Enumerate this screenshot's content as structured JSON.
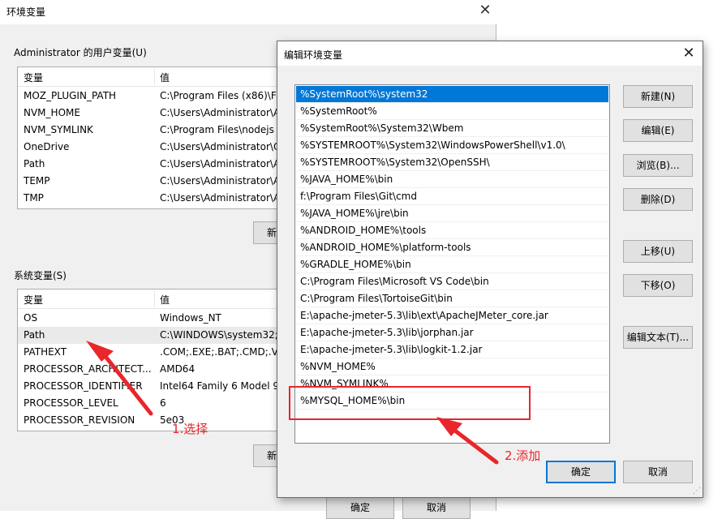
{
  "bg_window": {
    "title": "环境变量",
    "user_group_label": "Administrator 的用户变量(U)",
    "system_group_label": "系统变量(S)",
    "col_var": "变量",
    "col_val": "值",
    "user_vars": [
      {
        "name": "MOZ_PLUGIN_PATH",
        "value": "C:\\Program Files (x86)\\Fo"
      },
      {
        "name": "NVM_HOME",
        "value": "C:\\Users\\Administrator\\A"
      },
      {
        "name": "NVM_SYMLINK",
        "value": "C:\\Program Files\\nodejs"
      },
      {
        "name": "OneDrive",
        "value": "C:\\Users\\Administrator\\O"
      },
      {
        "name": "Path",
        "value": "C:\\Users\\Administrator\\A"
      },
      {
        "name": "TEMP",
        "value": "C:\\Users\\Administrator\\A"
      },
      {
        "name": "TMP",
        "value": "C:\\Users\\Administrator\\A"
      }
    ],
    "system_vars": [
      {
        "name": "OS",
        "value": "Windows_NT"
      },
      {
        "name": "Path",
        "value": "C:\\WINDOWS\\system32;C"
      },
      {
        "name": "PATHEXT",
        "value": ".COM;.EXE;.BAT;.CMD;.VB"
      },
      {
        "name": "PROCESSOR_ARCHITECT...",
        "value": "AMD64"
      },
      {
        "name": "PROCESSOR_IDENTIFIER",
        "value": "Intel64 Family 6 Model 94"
      },
      {
        "name": "PROCESSOR_LEVEL",
        "value": "6"
      },
      {
        "name": "PROCESSOR_REVISION",
        "value": "5e03"
      }
    ],
    "user_new_btn_partial": "新",
    "system_new_btn_partial": "新",
    "ok_label": "确定",
    "cancel_label": "取消"
  },
  "dialog": {
    "title": "编辑环境变量",
    "paths": [
      "%SystemRoot%\\system32",
      "%SystemRoot%",
      "%SystemRoot%\\System32\\Wbem",
      "%SYSTEMROOT%\\System32\\WindowsPowerShell\\v1.0\\",
      "%SYSTEMROOT%\\System32\\OpenSSH\\",
      "%JAVA_HOME%\\bin",
      "f:\\Program Files\\Git\\cmd",
      "%JAVA_HOME%\\jre\\bin",
      "%ANDROID_HOME%\\tools",
      "%ANDROID_HOME%\\platform-tools",
      "%GRADLE_HOME%\\bin",
      "C:\\Program Files\\Microsoft VS Code\\bin",
      "C:\\Program Files\\TortoiseGit\\bin",
      "E:\\apache-jmeter-5.3\\lib\\ext\\ApacheJMeter_core.jar",
      "E:\\apache-jmeter-5.3\\lib\\jorphan.jar",
      "E:\\apache-jmeter-5.3\\lib\\logkit-1.2.jar",
      "%NVM_HOME%",
      "%NVM_SYMLINK%",
      "%MYSQL_HOME%\\bin"
    ],
    "buttons": {
      "new": "新建(N)",
      "edit": "编辑(E)",
      "browse": "浏览(B)...",
      "delete": "删除(D)",
      "move_up": "上移(U)",
      "move_down": "下移(O)",
      "edit_text": "编辑文本(T)...",
      "ok": "确定",
      "cancel": "取消"
    }
  },
  "annotations": {
    "step1": "1.选择",
    "step2": "2.添加",
    "color": "#e8262b"
  }
}
